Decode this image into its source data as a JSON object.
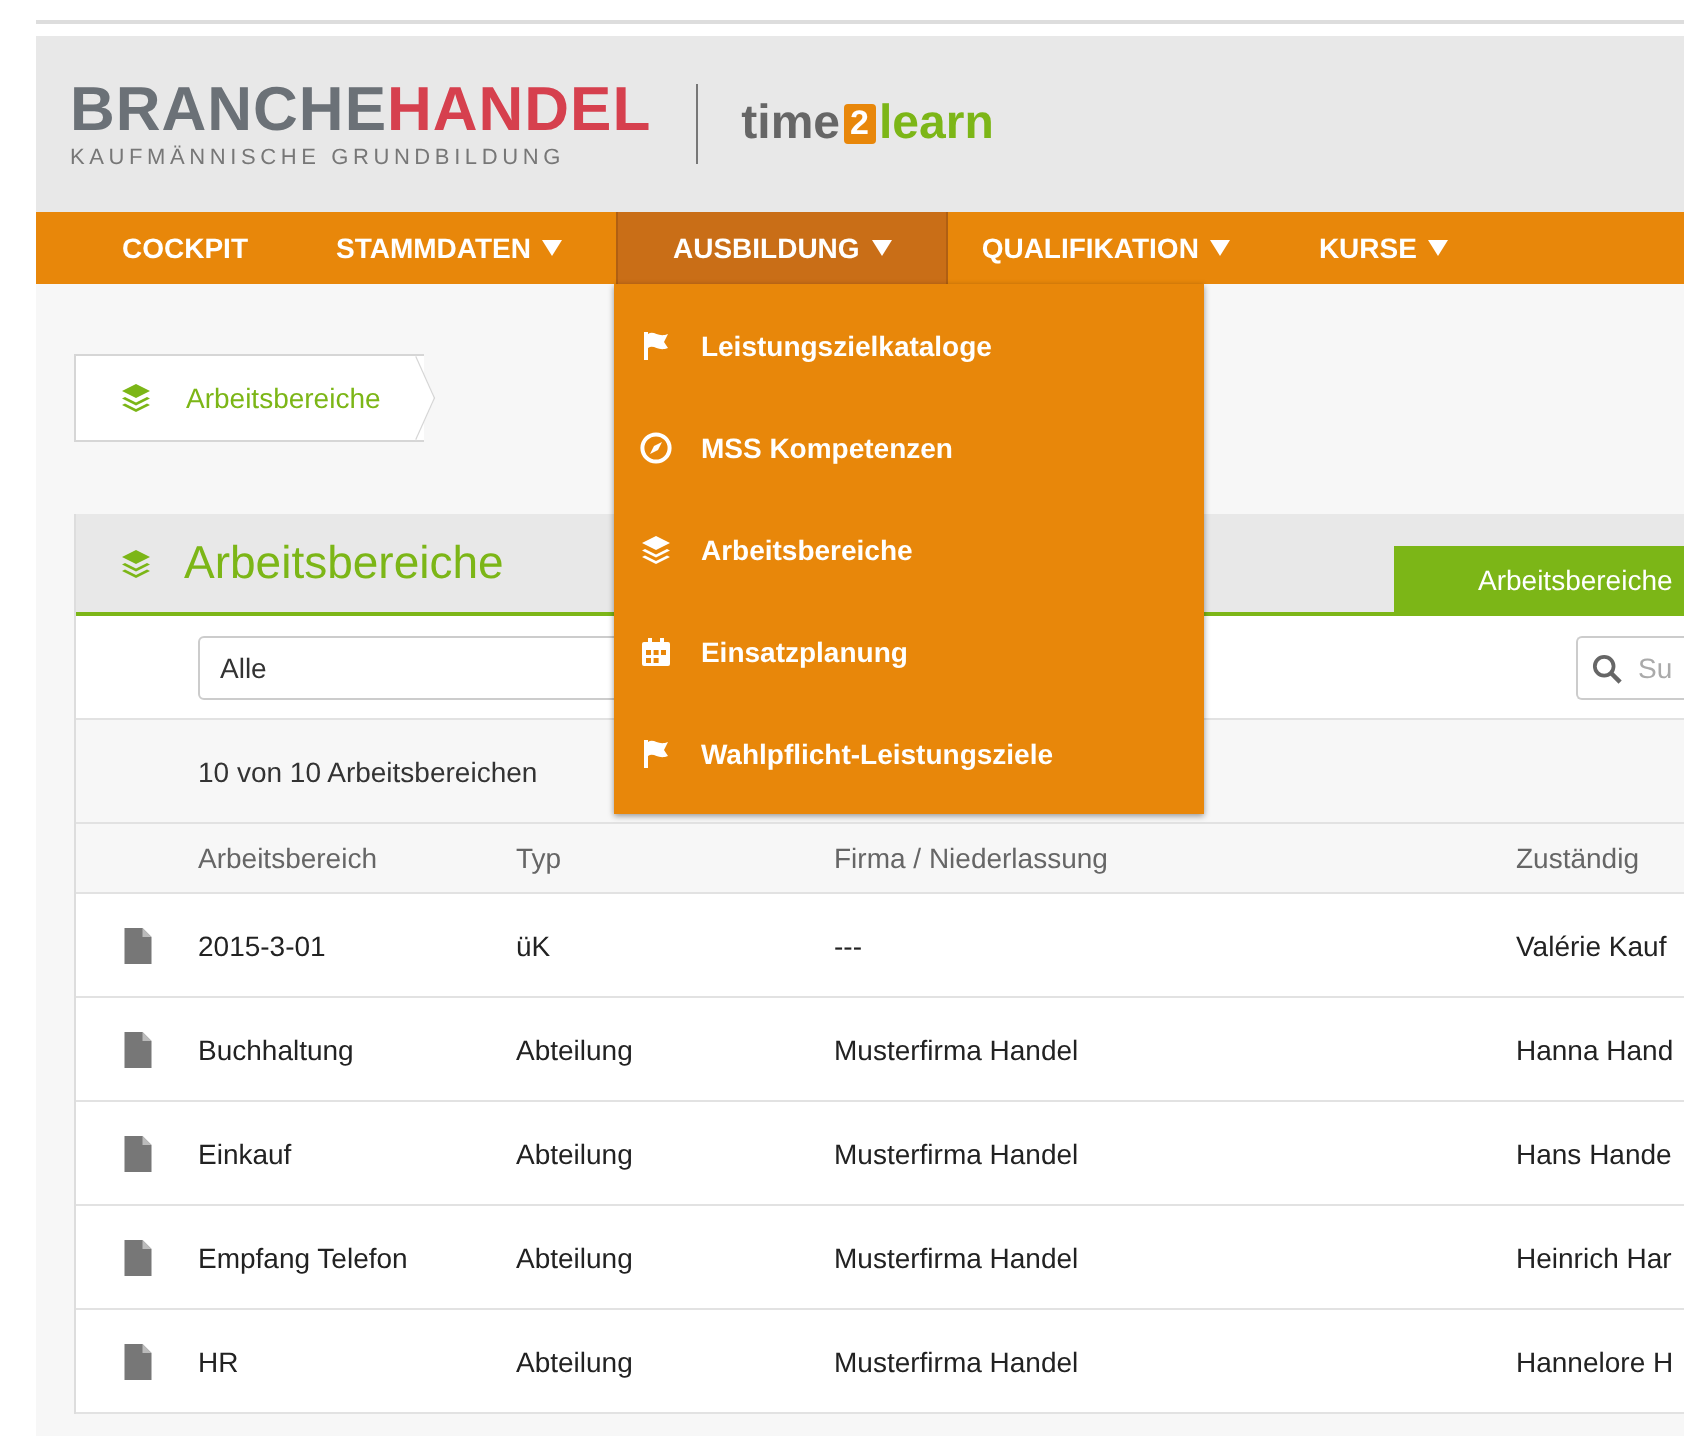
{
  "header": {
    "brand": {
      "part_1": "BRANCHE",
      "part_2": "HANDEL",
      "subtitle": "KAUFMÄNNISCHE GRUNDBILDUNG"
    },
    "product": {
      "part_1": "time",
      "part_2": "2",
      "part_3": "learn"
    }
  },
  "nav": [
    {
      "label": "COCKPIT",
      "selected": false,
      "dropdown": false
    },
    {
      "label": "STAMMDATEN",
      "selected": false,
      "dropdown": true
    },
    {
      "label": "AUSBILDUNG",
      "selected": true,
      "dropdown": true,
      "menu": [
        {
          "label": "Leistungszielkataloge",
          "kind": "flag"
        },
        {
          "label": "MSS Kompetenzen",
          "kind": "compass"
        },
        {
          "label": "Arbeitsbereiche",
          "kind": "layers"
        },
        {
          "label": "Einsatzplanung",
          "kind": "calendar"
        },
        {
          "label": "Wahlpflicht-Leistungsziele",
          "kind": "flag"
        }
      ]
    },
    {
      "label": "QUALIFIKATION",
      "selected": false,
      "dropdown": true
    },
    {
      "label": "KURSE",
      "selected": false,
      "dropdown": true
    }
  ],
  "breadcrumb": {
    "label": "Arbeitsbereiche"
  },
  "panel": {
    "title": "Arbeitsbereiche",
    "tab": "Arbeitsbereiche",
    "filter": {
      "value": "Alle"
    },
    "search": {
      "placeholder": "Su"
    },
    "count": "10 von 10 Arbeitsbereichen",
    "table": {
      "columns": [
        "Arbeitsbereich",
        "Typ",
        "Firma / Niederlassung",
        "Zuständig"
      ],
      "rows": [
        [
          "2015-3-01",
          "üK",
          "---",
          "Valérie Kauf"
        ],
        [
          "Buchhaltung",
          "Abteilung",
          "Musterfirma Handel",
          "Hanna Hand"
        ],
        [
          "Einkauf",
          "Abteilung",
          "Musterfirma Handel",
          "Hans Hande"
        ],
        [
          "Empfang Telefon",
          "Abteilung",
          "Musterfirma Handel",
          "Heinrich Har"
        ],
        [
          "HR",
          "Abteilung",
          "Musterfirma Handel",
          "Hannelore H"
        ]
      ]
    }
  }
}
